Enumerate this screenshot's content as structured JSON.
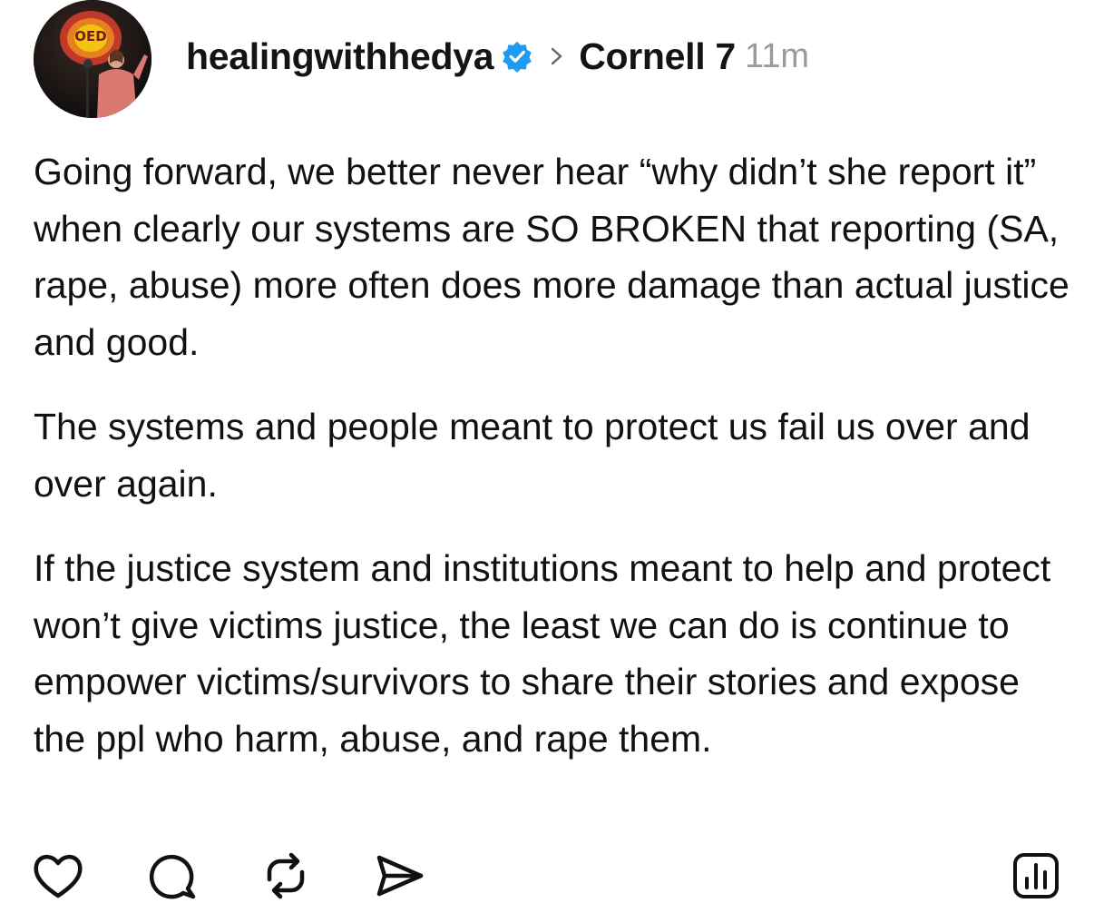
{
  "post": {
    "author": "healingwithhedya",
    "verified": true,
    "community": "Cornell 7",
    "time": "11m",
    "paragraphs": [
      "Going forward, we better never hear “why didn’t she report it” when clearly our systems are SO BROKEN that reporting (SA, rape, abuse) more often does more damage than actual justice and good.",
      "The systems and people meant to protect us fail us over and over again.",
      "If the justice system and institutions meant to help and protect  won’t give victims justice, the least we can do is continue to empower victims/survivors to share their stories and expose the ppl who harm, abuse, and rape them."
    ]
  },
  "avatar": {
    "sign_text": "OED"
  },
  "actions": {
    "like": "heart-icon",
    "comment": "comment-icon",
    "repost": "repost-icon",
    "share": "send-icon",
    "insights": "bar-chart-icon"
  },
  "colors": {
    "verified": "#1d9bf0",
    "time": "#9a9a9a",
    "text": "#111111"
  }
}
